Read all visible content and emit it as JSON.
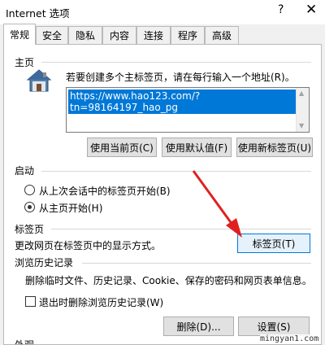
{
  "window": {
    "title": "Internet 选项",
    "help": "?",
    "close": "✕"
  },
  "tabs": [
    "常规",
    "安全",
    "隐私",
    "内容",
    "连接",
    "程序",
    "高级"
  ],
  "home": {
    "title": "主页",
    "description": "若要创建多个主标签页，请在每行输入一个地址(R)。",
    "url": "https://www.hao123.com/?tn=98164197_hao_pg",
    "buttons": {
      "use_current": "使用当前页(C)",
      "use_default": "使用默认值(F)",
      "use_new_tab": "使用新标签页(U)"
    }
  },
  "startup": {
    "title": "启动",
    "options": [
      "从上次会话中的标签页开始(B)",
      "从主页开始(H)"
    ],
    "selected": 1
  },
  "tabsgroup": {
    "title": "标签页",
    "description": "更改网页在标签页中的显示方式。",
    "button": "标签页(T)"
  },
  "history": {
    "title": "浏览历史记录",
    "description": "删除临时文件、历史记录、Cookie、保存的密码和网页表单信息。",
    "checkbox": "退出时删除浏览历史记录(W)",
    "checked": false,
    "delete_button": "删除(D)...",
    "settings_button": "设置(S)"
  },
  "appearance": {
    "title": "外观"
  },
  "watermark": "mingyan1.com",
  "colors": {
    "accent": "#0078d7",
    "arrow": "#e02020"
  },
  "icons": {
    "home": "home-icon",
    "arrow": "red-arrow-annotation"
  }
}
